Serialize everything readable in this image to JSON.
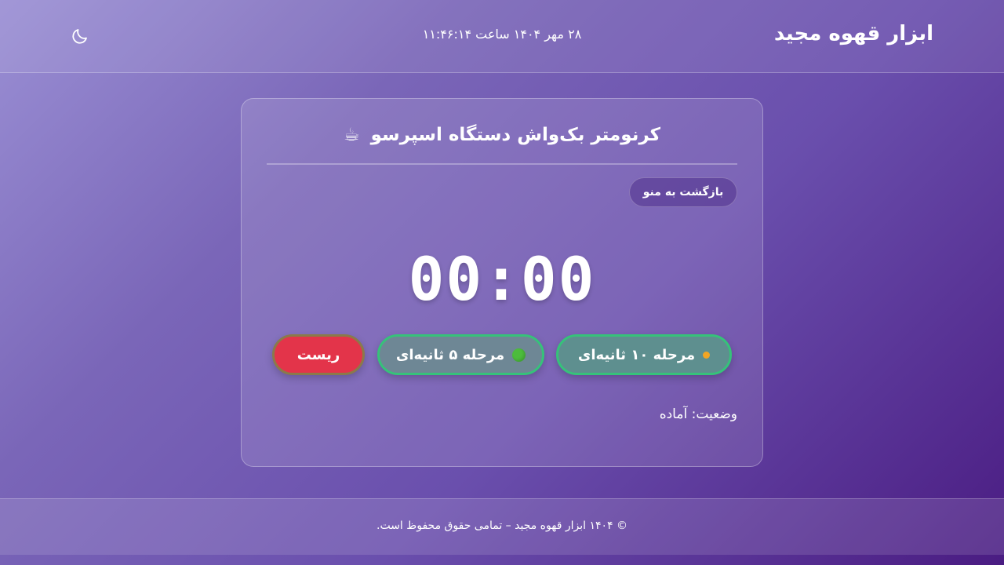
{
  "header": {
    "site_title": "ابزار قهوه مجید",
    "datetime": "۲۸ مهر ۱۴۰۴ ساعت ۱۱:۴۶:۱۴",
    "theme_toggle_icon": "moon-icon"
  },
  "card": {
    "title": "کرنومتر بک‌واش دستگاه اسپرسو",
    "title_icon": "coffee-cup-icon",
    "back_button_label": "بازگشت به منو",
    "timer": "00:00",
    "buttons": {
      "stage10_label": "مرحله ۱۰ ثانیه‌ای",
      "stage5_label": "مرحله ۵ ثانیه‌ای",
      "reset_label": "ریست"
    },
    "status": "وضعیت: آماده"
  },
  "footer": {
    "text": "© ۱۴۰۴ ابزار قهوه مجید – تمامی حقوق محفوظ است."
  },
  "colors": {
    "stage_border": "#36c27a",
    "reset": "#e3344a",
    "orange_dot": "#f2a524",
    "green_dot": "#4cbc3c"
  }
}
